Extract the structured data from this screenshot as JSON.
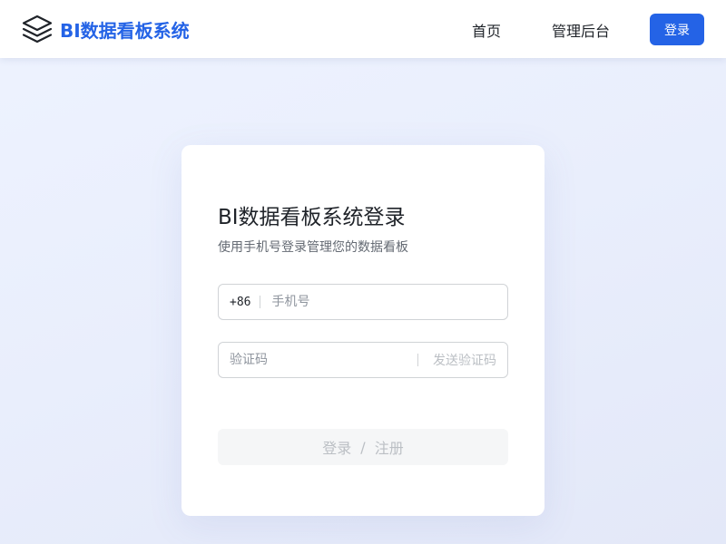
{
  "header": {
    "brand": "BI数据看板系统",
    "logo_icon": "layers-icon",
    "nav": [
      {
        "label": "首页"
      },
      {
        "label": "管理后台"
      }
    ],
    "login_label": "登录"
  },
  "card": {
    "title": "BI数据看板系统登录",
    "subtitle": "使用手机号登录管理您的数据看板",
    "phone": {
      "prefix": "+86",
      "placeholder": "手机号",
      "value": ""
    },
    "code": {
      "placeholder": "验证码",
      "value": "",
      "send_label": "发送验证码"
    },
    "submit": {
      "login": "登录",
      "separator": "/",
      "register": "注册"
    }
  },
  "colors": {
    "accent": "#2463e6",
    "text": "#1f2329",
    "muted": "#646a73",
    "disabled": "#bbbfc4"
  }
}
